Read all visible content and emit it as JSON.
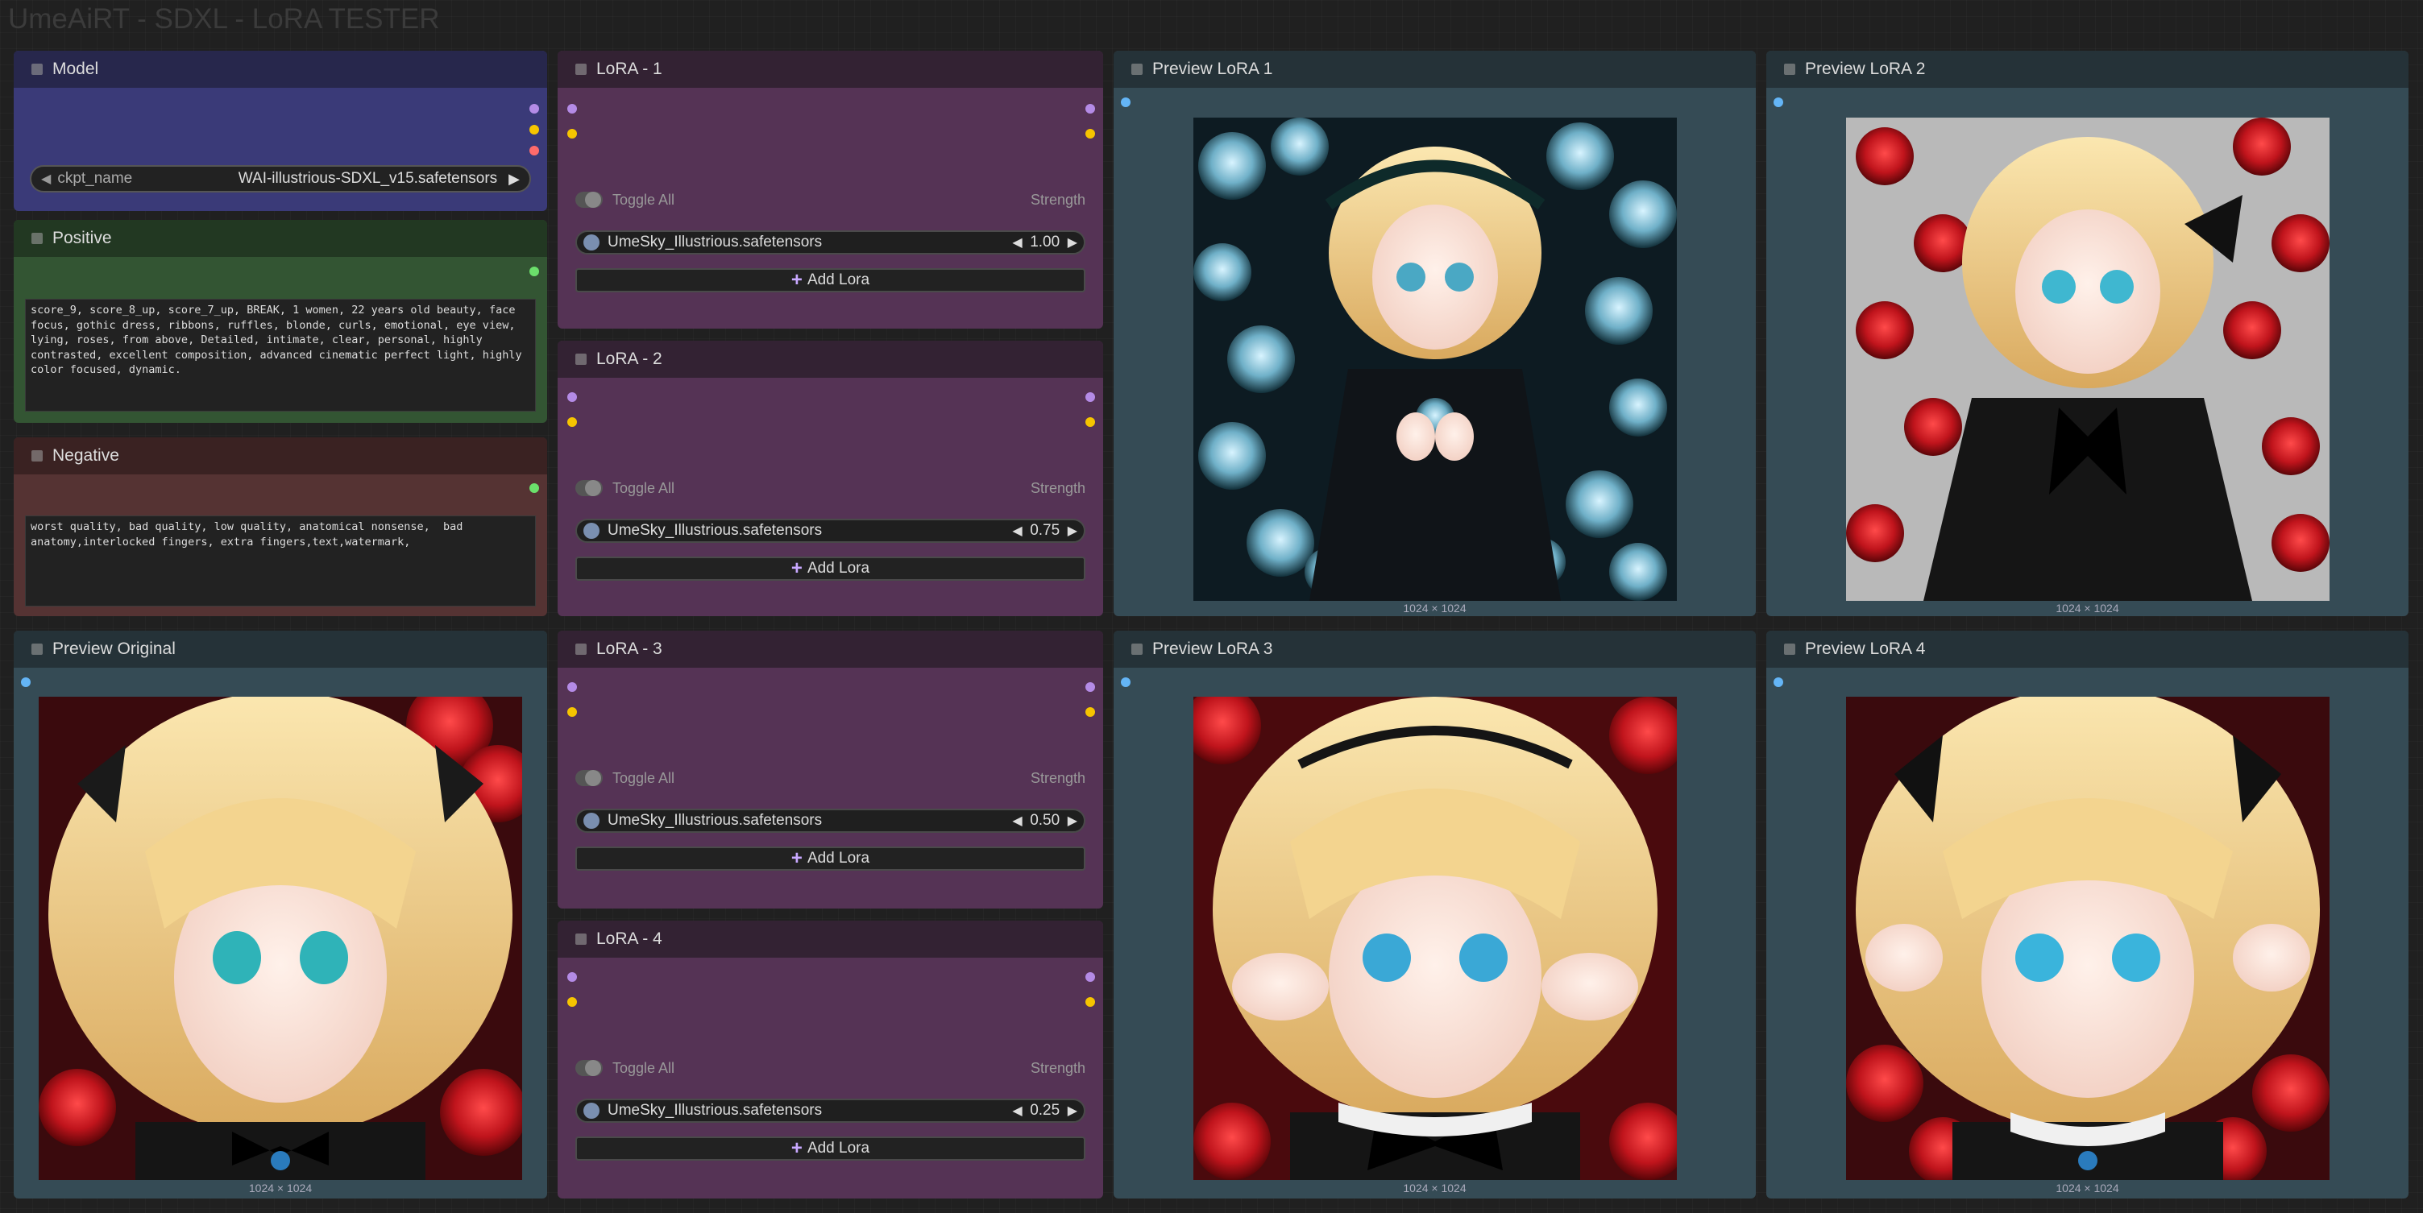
{
  "workflow_title": "UmeAiRT - SDXL - LoRA TESTER",
  "model": {
    "title": "Model",
    "ckpt_label": "ckpt_name",
    "ckpt_value": "WAI-illustrious-SDXL_v15.safetensors"
  },
  "positive": {
    "title": "Positive",
    "text": "score_9, score_8_up, score_7_up, BREAK, 1 women, 22 years old beauty, face focus, gothic dress, ribbons, ruffles, blonde, curls, emotional, eye view, lying, roses, from above, Detailed, intimate, clear, personal, highly contrasted, excellent composition, advanced cinematic perfect light, highly color focused, dynamic."
  },
  "negative": {
    "title": "Negative",
    "text": "worst quality, bad quality, low quality, anatomical nonsense,  bad anatomy,interlocked fingers, extra fingers,text,watermark,"
  },
  "loras": [
    {
      "title": "LoRA - 1",
      "toggle_label": "Toggle All",
      "strength_label": "Strength",
      "file": "UmeSky_Illustrious.safetensors",
      "strength": "1.00",
      "add_label": "Add Lora"
    },
    {
      "title": "LoRA - 2",
      "toggle_label": "Toggle All",
      "strength_label": "Strength",
      "file": "UmeSky_Illustrious.safetensors",
      "strength": "0.75",
      "add_label": "Add Lora"
    },
    {
      "title": "LoRA - 3",
      "toggle_label": "Toggle All",
      "strength_label": "Strength",
      "file": "UmeSky_Illustrious.safetensors",
      "strength": "0.50",
      "add_label": "Add Lora"
    },
    {
      "title": "LoRA - 4",
      "toggle_label": "Toggle All",
      "strength_label": "Strength",
      "file": "UmeSky_Illustrious.safetensors",
      "strength": "0.25",
      "add_label": "Add Lora"
    }
  ],
  "previews": {
    "original": {
      "title": "Preview Original",
      "size": "1024 × 1024"
    },
    "lora1": {
      "title": "Preview LoRA 1",
      "size": "1024 × 1024"
    },
    "lora2": {
      "title": "Preview LoRA 2",
      "size": "1024 × 1024"
    },
    "lora3": {
      "title": "Preview LoRA 3",
      "size": "1024 × 1024"
    },
    "lora4": {
      "title": "Preview LoRA 4",
      "size": "1024 × 1024"
    }
  },
  "colors": {
    "model_body": "#3a3a78",
    "positive_body": "#335533",
    "negative_body": "#553333",
    "lora_body": "#553355",
    "preview_body": "#354b55"
  }
}
